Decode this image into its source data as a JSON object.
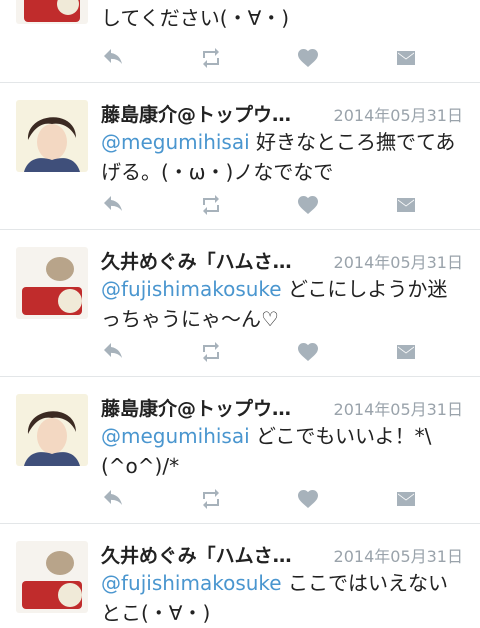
{
  "tweets": [
    {
      "name": "",
      "date": "",
      "mention": "",
      "text": "してください(・∀・)",
      "avatar": "hamster"
    },
    {
      "name": "藤島康介@トップウ…",
      "date": "2014年05月31日",
      "mention": "@megumihisai",
      "text": " 好きなところ撫でてあげる。(・ω・)ノなでなで",
      "avatar": "illustrated-man"
    },
    {
      "name": "久井めぐみ「ハムさ…",
      "date": "2014年05月31日",
      "mention": "@fujishimakosuke",
      "text": " どこにしようか迷っちゃうにゃ〜ん♡",
      "avatar": "hamster"
    },
    {
      "name": "藤島康介@トップウ…",
      "date": "2014年05月31日",
      "mention": "@megumihisai",
      "text": " どこでもいいよ！*\\(^o^)/*",
      "avatar": "illustrated-man"
    },
    {
      "name": "久井めぐみ「ハムさ…",
      "date": "2014年05月31日",
      "mention": "@fujishimakosuke",
      "text": " ここではいえないとこ(・∀・)",
      "avatar": "hamster"
    }
  ],
  "icons": {
    "reply": "reply-icon",
    "retweet": "retweet-icon",
    "favorite": "heart-icon",
    "dm": "envelope-icon"
  },
  "colors": {
    "mention": "#4a96cf",
    "icon": "#a7b2bb",
    "date": "#9aa3ab"
  }
}
